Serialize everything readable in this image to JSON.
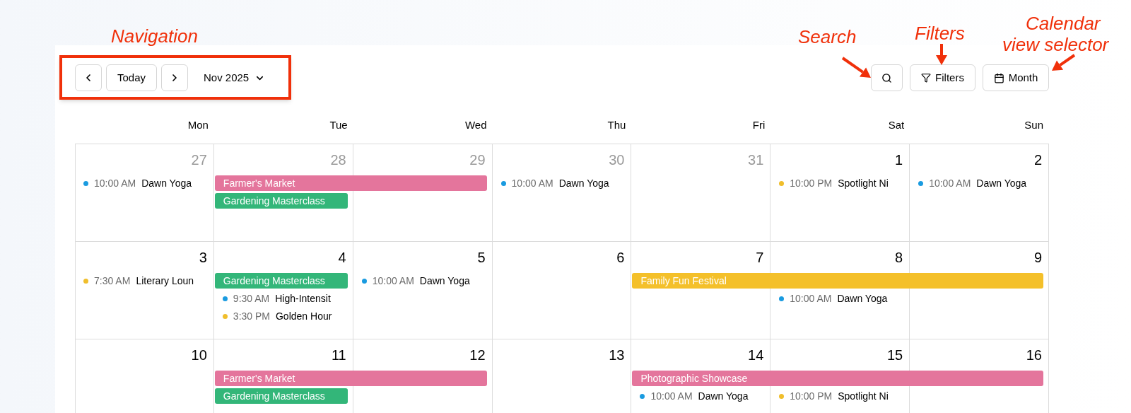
{
  "annotations": [
    {
      "kind": "label",
      "text": "Navigation"
    },
    {
      "kind": "label",
      "text": "Search"
    },
    {
      "kind": "label",
      "text": "Filters"
    },
    {
      "kind": "label",
      "text": "Calendar"
    },
    {
      "kind": "label",
      "text": "view selector"
    }
  ],
  "toolbar": {
    "today": "Today",
    "period": "Nov 2025",
    "filters": "Filters",
    "view": "Month"
  },
  "weekdays": [
    "Mon",
    "Tue",
    "Wed",
    "Thu",
    "Fri",
    "Sat",
    "Sun"
  ],
  "weeks": [
    {
      "days": [
        {
          "number": "27",
          "muted": true,
          "items": [
            {
              "kind": "timed",
              "time": "10:00 AM",
              "title": "Dawn Yoga",
              "color": "#1a9be0"
            }
          ]
        },
        {
          "number": "28",
          "muted": true,
          "items": [
            {
              "kind": "bar",
              "title": "Farmer's Market",
              "color": "#e4759c",
              "continued": false
            },
            {
              "kind": "bar",
              "title": "Gardening Masterclass",
              "color": "#33b679",
              "continued": false
            }
          ]
        },
        {
          "number": "29",
          "muted": true,
          "items": [
            {
              "kind": "bar",
              "continued": true
            }
          ]
        },
        {
          "number": "30",
          "muted": true,
          "items": [
            {
              "kind": "timed",
              "time": "10:00 AM",
              "title": "Dawn Yoga",
              "color": "#1a9be0"
            }
          ]
        },
        {
          "number": "31",
          "muted": true
        },
        {
          "number": "1",
          "muted": false,
          "items": [
            {
              "kind": "timed",
              "time": "10:00 PM",
              "title": "Spotlight Ni",
              "color": "#f0be2c"
            }
          ]
        },
        {
          "number": "2",
          "muted": false,
          "items": [
            {
              "kind": "timed",
              "time": "10:00 AM",
              "title": "Dawn Yoga",
              "color": "#1a9be0"
            }
          ]
        }
      ]
    },
    {
      "days": [
        {
          "number": "3",
          "muted": false,
          "items": [
            {
              "kind": "timed",
              "time": "7:30 AM",
              "title": "Literary Loun",
              "color": "#f0be2c"
            }
          ]
        },
        {
          "number": "4",
          "muted": false,
          "items": [
            {
              "kind": "bar",
              "title": "Gardening Masterclass",
              "color": "#33b679",
              "continued": false
            },
            {
              "kind": "timed",
              "time": "9:30 AM",
              "title": "High-Intensit",
              "color": "#1a9be0"
            },
            {
              "kind": "timed",
              "time": "3:30 PM",
              "title": "Golden Hour",
              "color": "#f0be2c"
            }
          ]
        },
        {
          "number": "5",
          "muted": false,
          "items": [
            {
              "kind": "timed",
              "time": "10:00 AM",
              "title": "Dawn Yoga",
              "color": "#1a9be0"
            }
          ]
        },
        {
          "number": "6",
          "muted": false
        },
        {
          "number": "7",
          "muted": false,
          "items": [
            {
              "kind": "bar",
              "title": "Family Fun Festival",
              "color": "#f4c02a",
              "continued": false
            }
          ]
        },
        {
          "number": "8",
          "muted": false,
          "items": [
            {
              "kind": "bar",
              "continued": true
            },
            {
              "kind": "timed",
              "time": "10:00 AM",
              "title": "Dawn Yoga",
              "color": "#1a9be0"
            }
          ]
        },
        {
          "number": "9",
          "muted": false,
          "items": [
            {
              "kind": "bar",
              "continued": true
            }
          ]
        }
      ]
    },
    {
      "days": [
        {
          "number": "10",
          "muted": false
        },
        {
          "number": "11",
          "muted": false,
          "items": [
            {
              "kind": "bar",
              "title": "Farmer's Market",
              "color": "#e4759c",
              "continued": false
            },
            {
              "kind": "bar",
              "title": "Gardening Masterclass",
              "color": "#33b679",
              "continued": false
            }
          ]
        },
        {
          "number": "12",
          "muted": false,
          "items": [
            {
              "kind": "bar",
              "continued": true
            }
          ]
        },
        {
          "number": "13",
          "muted": false
        },
        {
          "number": "14",
          "muted": false,
          "items": [
            {
              "kind": "bar",
              "title": "Photographic Showcase",
              "color": "#e4759c",
              "continued": false
            },
            {
              "kind": "timed",
              "time": "10:00 AM",
              "title": "Dawn Yoga",
              "color": "#1a9be0"
            }
          ]
        },
        {
          "number": "15",
          "muted": false,
          "items": [
            {
              "kind": "bar",
              "continued": true
            },
            {
              "kind": "timed",
              "time": "10:00 PM",
              "title": "Spotlight Ni",
              "color": "#f0be2c"
            }
          ]
        },
        {
          "number": "16",
          "muted": false,
          "items": [
            {
              "kind": "bar",
              "continued": true
            }
          ]
        }
      ]
    }
  ]
}
